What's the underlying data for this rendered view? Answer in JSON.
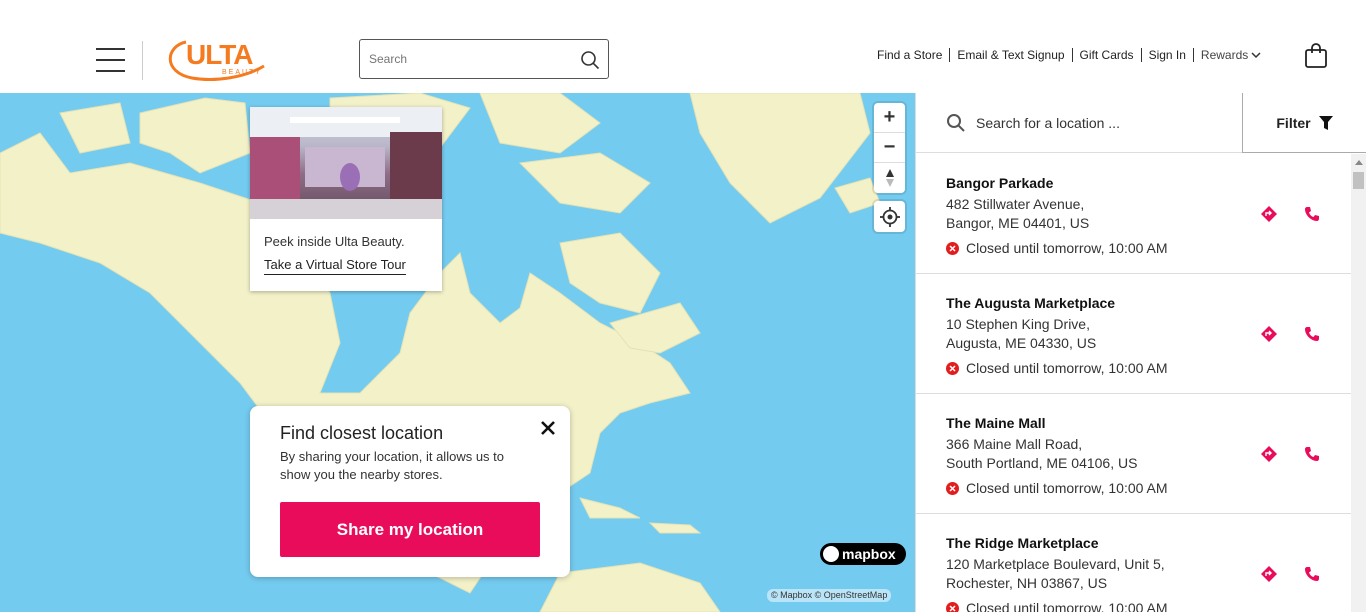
{
  "header": {
    "logo_text": "ULTA",
    "logo_subtext": "BEAUTY",
    "search_placeholder": "Search",
    "links": [
      "Find a Store",
      "Email & Text Signup",
      "Gift Cards",
      "Sign In"
    ],
    "rewards_label": "Rewards",
    "brand_color": "#f47b20"
  },
  "map": {
    "tour_card": {
      "text": "Peek inside Ulta Beauty.",
      "link": "Take a Virtual Store Tour"
    },
    "share_card": {
      "title": "Find closest location",
      "body": "By sharing your location, it allows us to show you the nearby stores.",
      "button": "Share my location",
      "button_color": "#e80c5b"
    },
    "zoom_in": "+",
    "zoom_out": "−",
    "mapbox_label": "mapbox",
    "attribution": "© Mapbox © OpenStreetMap"
  },
  "panel": {
    "search_placeholder": "Search for a location ...",
    "filter_label": "Filter",
    "stores": [
      {
        "name": "Bangor Parkade",
        "address1": "482 Stillwater Avenue,",
        "address2": "Bangor, ME 04401, US",
        "status": "Closed until tomorrow, 10:00 AM"
      },
      {
        "name": "The Augusta Marketplace",
        "address1": "10 Stephen King Drive,",
        "address2": "Augusta, ME 04330, US",
        "status": "Closed until tomorrow, 10:00 AM"
      },
      {
        "name": "The Maine Mall",
        "address1": "366 Maine Mall Road,",
        "address2": "South Portland, ME 04106, US",
        "status": "Closed until tomorrow, 10:00 AM"
      },
      {
        "name": "The Ridge Marketplace",
        "address1": "120 Marketplace Boulevard, Unit 5,",
        "address2": "Rochester, NH 03867, US",
        "status": "Closed until tomorrow, 10:00 AM"
      }
    ]
  }
}
